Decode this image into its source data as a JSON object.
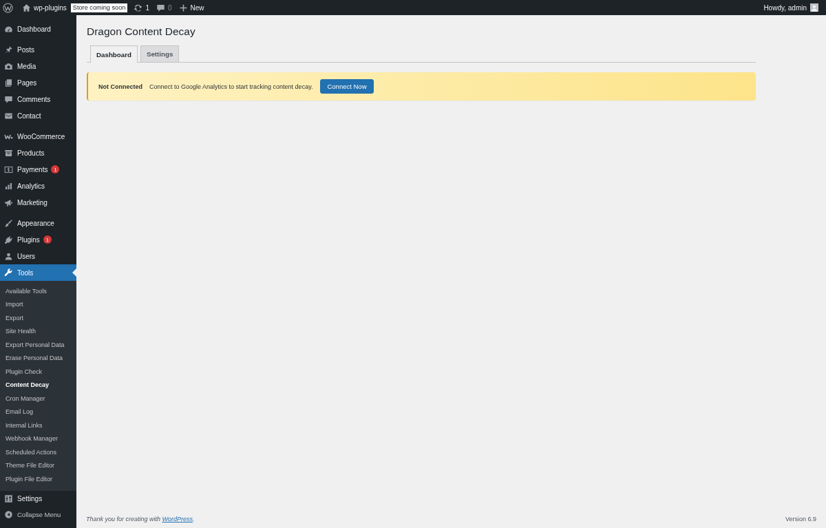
{
  "admin_bar": {
    "site_name": "wp-plugins",
    "store_badge": "Store coming soon",
    "updates_count": "1",
    "comments_count": "0",
    "new_label": "New",
    "greeting": "Howdy, admin"
  },
  "sidebar": {
    "groups": [
      {
        "items": [
          {
            "label": "Dashboard",
            "selected": false
          }
        ]
      },
      {
        "items": [
          {
            "label": "Posts",
            "selected": false
          },
          {
            "label": "Media",
            "selected": false
          },
          {
            "label": "Pages",
            "selected": false
          },
          {
            "label": "Comments",
            "selected": false
          },
          {
            "label": "Contact",
            "selected": false
          }
        ]
      },
      {
        "items": [
          {
            "label": "WooCommerce",
            "selected": false
          },
          {
            "label": "Products",
            "selected": false
          },
          {
            "label": "Payments",
            "selected": false,
            "badge": "1"
          },
          {
            "label": "Analytics",
            "selected": false
          },
          {
            "label": "Marketing",
            "selected": false
          }
        ]
      },
      {
        "items": [
          {
            "label": "Appearance",
            "selected": false
          },
          {
            "label": "Plugins",
            "selected": false,
            "badge": "1"
          },
          {
            "label": "Users",
            "selected": false
          },
          {
            "label": "Tools",
            "selected": true,
            "children": [
              {
                "label": "Available Tools",
                "selected": false
              },
              {
                "label": "Import",
                "selected": false
              },
              {
                "label": "Export",
                "selected": false
              },
              {
                "label": "Site Health",
                "selected": false
              },
              {
                "label": "Export Personal Data",
                "selected": false
              },
              {
                "label": "Erase Personal Data",
                "selected": false
              },
              {
                "label": "Plugin Check",
                "selected": false
              },
              {
                "label": "Content Decay",
                "selected": true
              },
              {
                "label": "Cron Manager",
                "selected": false
              },
              {
                "label": "Email Log",
                "selected": false
              },
              {
                "label": "Internal Links",
                "selected": false
              },
              {
                "label": "Webhook Manager",
                "selected": false
              },
              {
                "label": "Scheduled Actions",
                "selected": false
              },
              {
                "label": "Theme File Editor",
                "selected": false
              },
              {
                "label": "Plugin File Editor",
                "selected": false
              }
            ]
          },
          {
            "label": "Settings",
            "selected": false
          }
        ]
      }
    ],
    "collapse_label": "Collapse Menu"
  },
  "page": {
    "title": "Dragon Content Decay",
    "tabs": [
      {
        "label": "Dashboard",
        "selected": true
      },
      {
        "label": "Settings",
        "selected": false
      }
    ],
    "notice": {
      "title": "Not Connected",
      "message": "Connect to Google Analytics to start tracking content decay.",
      "button": "Connect Now"
    }
  },
  "footer": {
    "credit_before": "Thank you for creating with ",
    "credit_link": "WordPress",
    "credit_after": ".",
    "version": "Version 6.9"
  }
}
